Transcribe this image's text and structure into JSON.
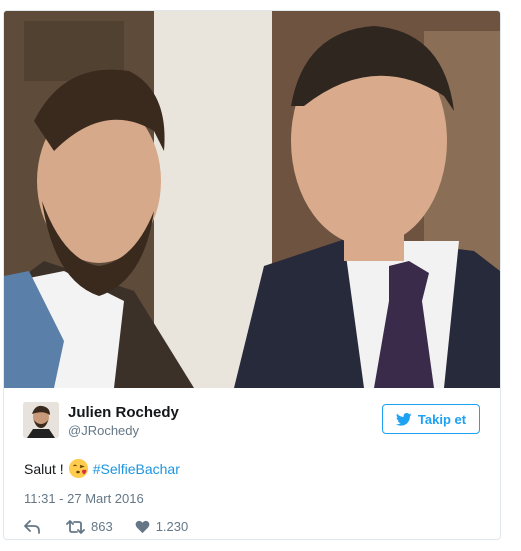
{
  "tweet": {
    "author_name": "Julien Rochedy",
    "author_handle": "@JRochedy",
    "follow_label": "Takip et",
    "text_before": "Salut !",
    "emoji": "face-blowing-kiss",
    "hashtag": "#SelfieBachar",
    "timestamp": "11:31 - 27 Mart 2016",
    "retweet_count": "863",
    "like_count": "1.230"
  },
  "colors": {
    "accent": "#1da1f2",
    "hashtag": "#1b95e0",
    "muted": "#657786",
    "text": "#14171a",
    "border": "#e1e8ed"
  },
  "icons": {
    "follow": "twitter-bird-icon",
    "reply": "reply-icon",
    "retweet": "retweet-icon",
    "like": "heart-icon"
  }
}
